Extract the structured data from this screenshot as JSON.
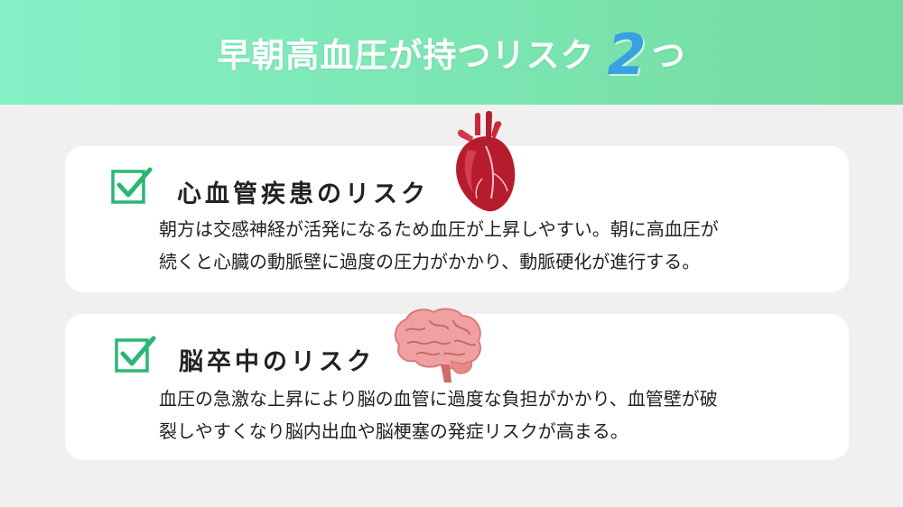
{
  "header": {
    "title": "早朝高血圧が持つリスク",
    "number": "2",
    "suffix": "つ"
  },
  "cards": [
    {
      "title": "心血管疾患のリスク",
      "body_line1": "朝方は交感神経が活発になるため血圧が上昇しやすい。朝に高血圧が",
      "body_line2": "続くと心臓の動脈壁に過度の圧力がかかり、動脈硬化が進行する。",
      "icon": "heart-icon"
    },
    {
      "title": "脳卒中のリスク",
      "body_line1": "血圧の急激な上昇により脳の血管に過度な負担がかかり、血管壁が破",
      "body_line2": "裂しやすくなり脳内出血や脳梗塞の発症リスクが高まる。",
      "icon": "brain-icon"
    }
  ],
  "colors": {
    "header_start": "#84f0c6",
    "header_end": "#74dca0",
    "check_green": "#2bb673",
    "number_blue": "#3aa0e0"
  }
}
